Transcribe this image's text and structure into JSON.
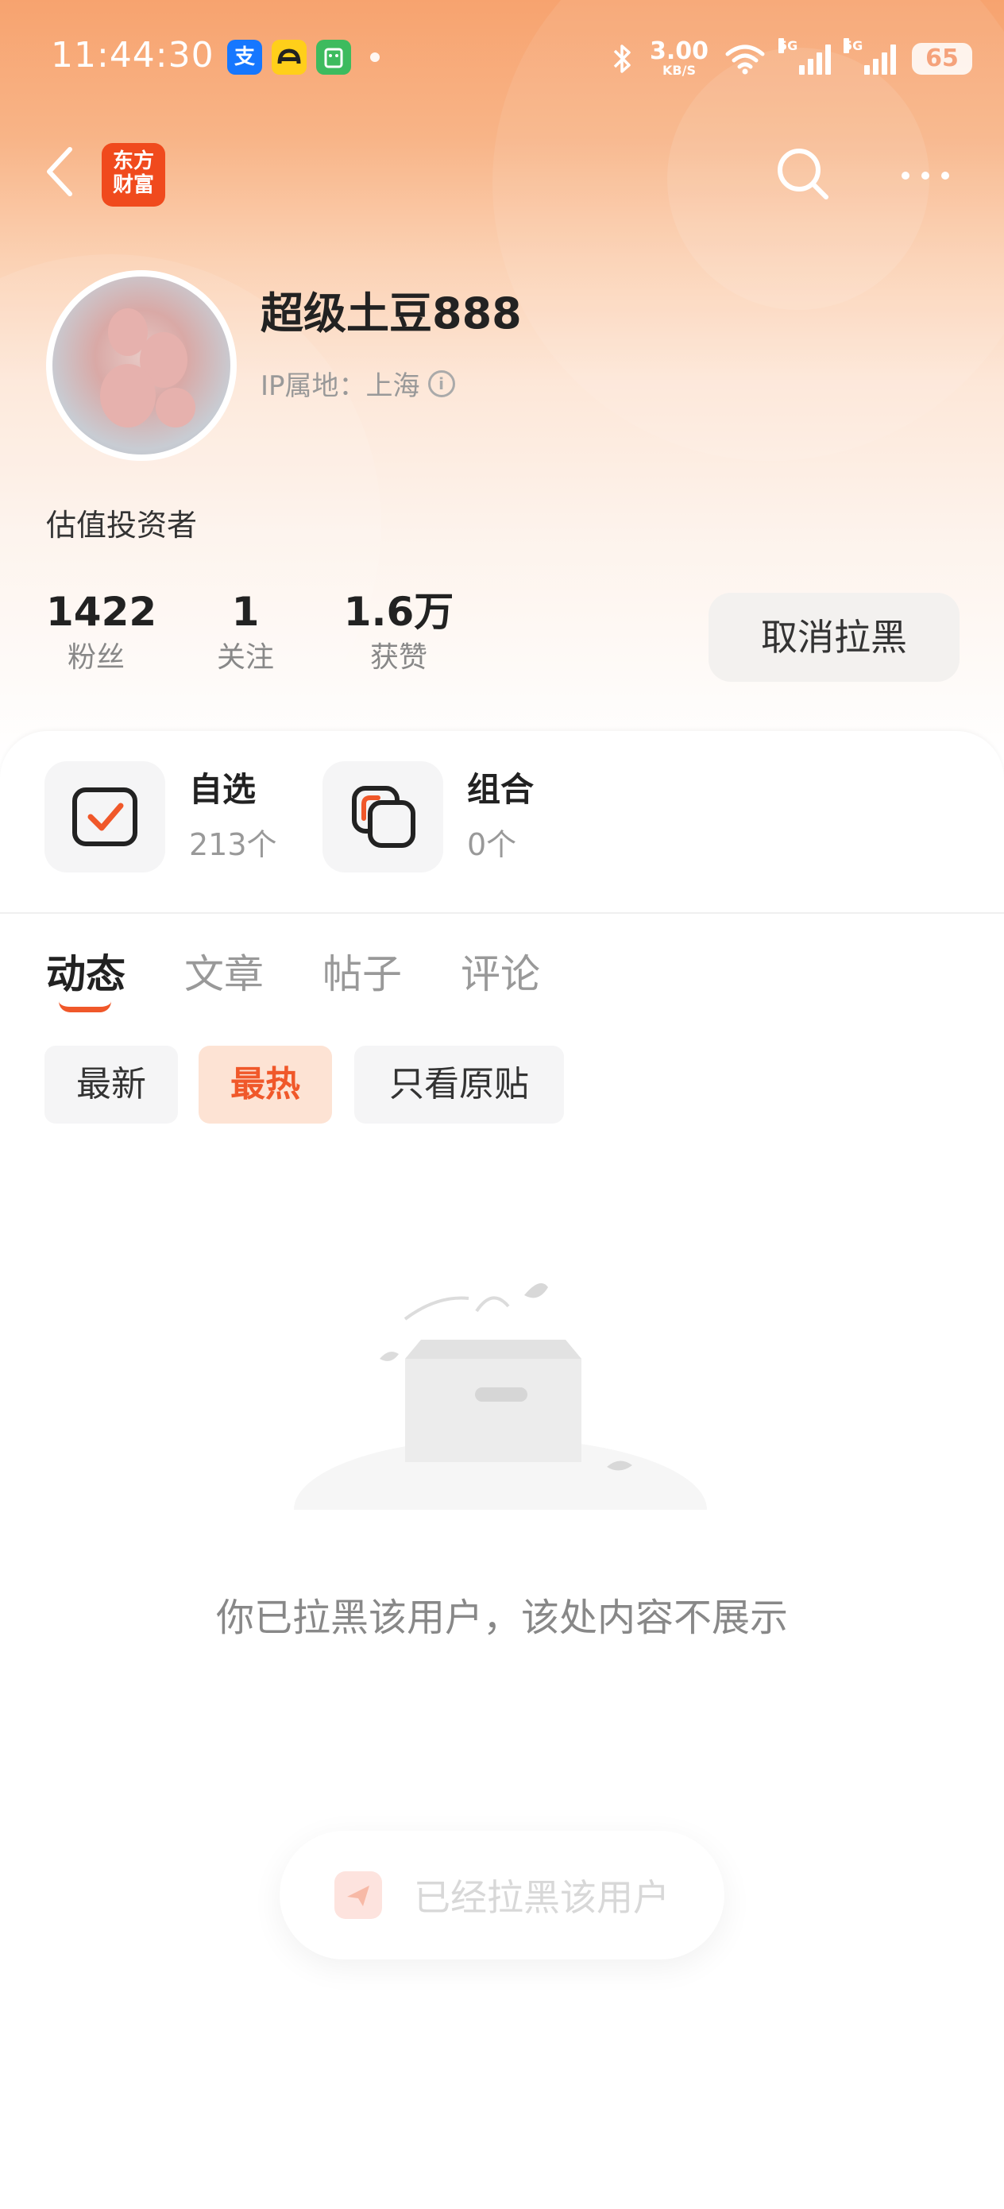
{
  "status_bar": {
    "time": "11:44:30",
    "net_speed_value": "3.00",
    "net_speed_unit": "KB/S",
    "signal_tag_1": "5G",
    "signal_tag_2": "5G",
    "battery": "65"
  },
  "nav": {
    "logo_line1": "东方",
    "logo_line2": "财富"
  },
  "profile": {
    "username": "超级土豆888",
    "ip_location": "IP属地：上海",
    "bio": "估值投资者"
  },
  "stats": [
    {
      "value": "1422",
      "label": "粉丝"
    },
    {
      "value": "1",
      "label": "关注"
    },
    {
      "value": "1.6万",
      "label": "获赞"
    }
  ],
  "unblock_button": "取消拉黑",
  "assets": [
    {
      "title": "自选",
      "count": "213个"
    },
    {
      "title": "组合",
      "count": "0个"
    }
  ],
  "tabs": [
    {
      "label": "动态",
      "active": true
    },
    {
      "label": "文章",
      "active": false
    },
    {
      "label": "帖子",
      "active": false
    },
    {
      "label": "评论",
      "active": false
    }
  ],
  "filters": [
    {
      "label": "最新",
      "active": false
    },
    {
      "label": "最热",
      "active": true
    },
    {
      "label": "只看原贴",
      "active": false
    }
  ],
  "empty_message": "你已拉黑该用户，该处内容不展示",
  "toast": "已经拉黑该用户",
  "colors": {
    "accent": "#f0582a",
    "header_orange": "#f7a36f",
    "chip_active_bg": "#fde3d4"
  },
  "icons": {
    "back": "chevron-left-icon",
    "search": "search-icon",
    "more": "more-dots-icon",
    "info": "info-icon",
    "watchlist": "checkbox-check-icon",
    "portfolio": "stacked-squares-icon",
    "empty": "empty-box-icon",
    "toast": "paper-plane-icon"
  }
}
